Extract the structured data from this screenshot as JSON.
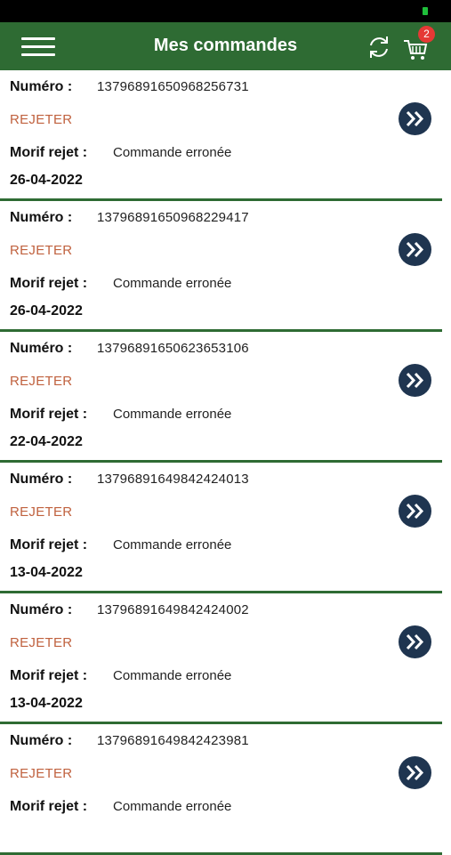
{
  "header": {
    "title": "Mes commandes",
    "cart_badge": "2"
  },
  "labels": {
    "numero": "Numéro :",
    "motif": "Morif rejet :"
  },
  "orders": [
    {
      "numero": "13796891650968256731",
      "status": "REJETER",
      "motif": "Commande erronée",
      "date": "26-04-2022"
    },
    {
      "numero": "13796891650968229417",
      "status": "REJETER",
      "motif": "Commande erronée",
      "date": "26-04-2022"
    },
    {
      "numero": "13796891650623653106",
      "status": "REJETER",
      "motif": "Commande erronée",
      "date": "22-04-2022"
    },
    {
      "numero": "13796891649842424013",
      "status": "REJETER",
      "motif": "Commande erronée",
      "date": "13-04-2022"
    },
    {
      "numero": "13796891649842424002",
      "status": "REJETER",
      "motif": "Commande erronée",
      "date": "13-04-2022"
    },
    {
      "numero": "13796891649842423981",
      "status": "REJETER",
      "motif": "Commande erronée",
      "date": ""
    }
  ],
  "colors": {
    "header_bg": "#2e6b33",
    "status_rejected": "#c0613e",
    "detail_button": "#1f3550",
    "badge": "#e53935"
  },
  "icons": {
    "menu": "hamburger-menu-icon",
    "refresh": "refresh-icon",
    "cart": "shopping-cart-icon",
    "detail": "double-chevron-right-icon"
  }
}
